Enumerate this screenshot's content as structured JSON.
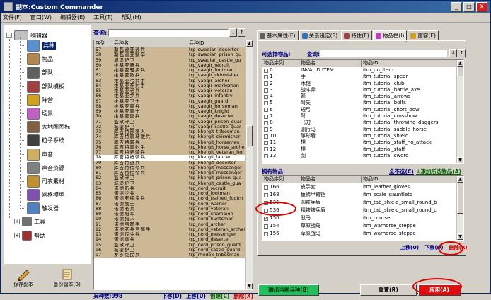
{
  "window": {
    "title": "副本:Custom Commander",
    "min": "_",
    "max": "□",
    "close": "X"
  },
  "menu": [
    "文件(F)",
    "窗口(W)",
    "编辑器(E)",
    "工具(T)",
    "帮助(H)"
  ],
  "tree": {
    "root": "编辑器",
    "items": [
      {
        "label": "兵种",
        "selected": true,
        "color": "#5a90d0"
      },
      {
        "label": "物品",
        "color": "#b08850"
      },
      {
        "label": "部队",
        "color": "#606060"
      },
      {
        "label": "部队模板",
        "color": "#a04040"
      },
      {
        "label": "阵营",
        "color": "#d0a020"
      },
      {
        "label": "场景",
        "color": "#c060c0"
      },
      {
        "label": "大地图图标",
        "color": "#806040"
      },
      {
        "label": "粒子系统",
        "color": "#404040"
      },
      {
        "label": "声音",
        "color": "#d0b060"
      },
      {
        "label": "声音资源",
        "color": "#808080"
      },
      {
        "label": "司农素材",
        "color": "#c09030"
      },
      {
        "label": "网格模型",
        "color": "#8050b0"
      },
      {
        "label": "触发器",
        "color": "#5080c0"
      }
    ],
    "tools": "工具",
    "help": "帮助"
  },
  "left_buttons": {
    "save": "保存副本",
    "backup": "备份副本(B)"
  },
  "troops": {
    "search_label": "查询:",
    "up_arrow": "↓",
    "down_arrow": "↑",
    "columns": [
      "序列",
      "兵种名",
      "兵种ID"
    ],
    "rows": [
      [
        "57",
        "斯瓦迪亚逃兵",
        "trp_swadian_deserter"
      ],
      [
        "58",
        "斯瓦迪亚狱卒",
        "trp_swadian_prison_gu"
      ],
      [
        "59",
        "城堡护卫",
        "trp_swadian_castle_gu"
      ],
      [
        "60",
        "维基亚新兵",
        "trp_vaegir_recruit"
      ],
      [
        "61",
        "维基亚轻步兵",
        "trp_vaegir_footman"
      ],
      [
        "62",
        "维基亚散兵",
        "trp_vaegir_skirmisher"
      ],
      [
        "63",
        "维基亚弓箭手",
        "trp_vaegir_archer"
      ],
      [
        "64",
        "维基亚神射手",
        "trp_vaegir_marksman"
      ],
      [
        "65",
        "维基亚老兵",
        "trp_vaegir_veteran"
      ],
      [
        "66",
        "维基亚步兵",
        "trp_vaegir_infantry"
      ],
      [
        "67",
        "维基亚卫士",
        "trp_vaegir_guard"
      ],
      [
        "68",
        "维基亚骑兵",
        "trp_vaegir_horseman"
      ],
      [
        "69",
        "维基亚骑士",
        "trp_vaegir_knight"
      ],
      [
        "70",
        "维基亚逃兵",
        "trp_vaegir_deserter"
      ],
      [
        "71",
        "监狱守卫",
        "trp_vaegir_prison_guar"
      ],
      [
        "72",
        "城堡护卫",
        "trp_vaegir_castle_guar"
      ],
      [
        "73",
        "库吉特部落人",
        "trp_khergit_tribesman"
      ],
      [
        "74",
        "库吉特骑马散兵",
        "trp_khergit_skirmisher"
      ],
      [
        "75",
        "库吉特骑兵",
        "trp_khergit_horseman"
      ],
      [
        "76",
        "库吉特骑射手",
        "trp_khergit_horse_arche"
      ],
      [
        "77",
        "库吉特老骑兵",
        "trp_khergit_veteran_hor"
      ],
      [
        "78",
        "库吉特枪骑兵",
        "trp_khergit_lancer"
      ],
      [
        "79",
        "库吉特逃兵",
        "trp_khergit_deserter"
      ],
      [
        "80",
        "库吉特传令兵",
        "trp_khergit_messenger"
      ],
      [
        "81",
        "库吉特传令兵",
        "trp_khergit_messenger"
      ],
      [
        "82",
        "监狱守卫",
        "trp_khergit_prison_gua"
      ],
      [
        "83",
        "城堡护卫",
        "trp_khergit_castle_gua"
      ],
      [
        "84",
        "诺德新兵",
        "trp_nord_recruit"
      ],
      [
        "85",
        "诺德步兵",
        "trp_nord_footman"
      ],
      [
        "86",
        "诺德老练步兵",
        "trp_nord_trained_footm"
      ],
      [
        "87",
        "诺德战士",
        "trp_nord_warrior"
      ],
      [
        "88",
        "诺德老兵",
        "trp_nord_veteran"
      ],
      [
        "89",
        "诺德冠军",
        "trp_nord_champion"
      ],
      [
        "90",
        "诺德猎人",
        "trp_nord_huntsman"
      ],
      [
        "91",
        "诺德弓箭手",
        "trp_nord_archer"
      ],
      [
        "92",
        "诺德老兵弓箭手",
        "trp_nord_veteran_archer"
      ],
      [
        "93",
        "诺德传令兵",
        "trp_nord_messenger"
      ],
      [
        "94",
        "诺德逃兵",
        "trp_nord_deserter"
      ],
      [
        "95",
        "监狱守卫",
        "trp_nord_prison_guard"
      ],
      [
        "96",
        "城堡护卫",
        "trp_nord_castle_guard"
      ],
      [
        "97",
        "罗多克民兵",
        "trp_rhodok_tribesman"
      ]
    ],
    "highlighted_index": 21,
    "count_label": "兵种数:998",
    "links": {
      "down": "下移(D)",
      "up": "上移(U)",
      "create": "创建(C)",
      "delete": "删除(X)"
    }
  },
  "tabs": [
    "基本属性(E)",
    "关系设定(S)",
    "特性(E)",
    "物品栏(I)",
    "面容(E)"
  ],
  "active_tab": 3,
  "available": {
    "label": "可选择物品:",
    "search_label": "查询:",
    "columns": [
      "物品序列",
      "物品名",
      "物品ID"
    ],
    "rows": [
      [
        "0",
        "INVALID ITEM",
        "itm_no_item"
      ],
      [
        "1",
        "手",
        "itm_tutorial_spear"
      ],
      [
        "2",
        "木棍",
        "itm_tutorial_club"
      ],
      [
        "3",
        "战斗斧",
        "itm_tutorial_battle_axe"
      ],
      [
        "4",
        "箭",
        "itm_tutorial_arrows"
      ],
      [
        "5",
        "弩矢",
        "itm_tutorial_bolts"
      ],
      [
        "6",
        "短弓",
        "itm_tutorial_short_bow"
      ],
      [
        "7",
        "弩",
        "itm_tutorial_crossbow"
      ],
      [
        "8",
        "飞刀",
        "itm_tutorial_throwing_daggers"
      ],
      [
        "9",
        "驯行马",
        "itm_tutorial_saddle_horse"
      ],
      [
        "10",
        "箏形盾",
        "itm_tutorial_shield"
      ],
      [
        "11",
        "棍",
        "itm_tutorial_staff_no_attack"
      ],
      [
        "12",
        "棍",
        "itm_tutorial_staff"
      ],
      [
        "13",
        "剑",
        "itm_tutorial_sword"
      ]
    ]
  },
  "owned": {
    "label": "拥有物品:",
    "clear_all": "全不选(C)",
    "add_new": "添加所选物品(A)",
    "columns": [
      "物品序列",
      "物品名",
      "物品ID"
    ],
    "rows": [
      [
        "166",
        "皮手套",
        "itm_leather_gloves"
      ],
      [
        "168",
        "鱼鳞甲臂铠",
        "itm_scale_gauntlets"
      ],
      [
        "535",
        "圆铁兵盾",
        "itm_tab_shield_small_round_b"
      ],
      [
        "536",
        "精铁铁兵盾",
        "itm_tab_shield_small_round_c"
      ],
      [
        "150",
        "驳马",
        "itm_courser"
      ],
      [
        "154",
        "草原战马",
        "itm_warhorse_steppe"
      ],
      [
        "156",
        "草原战马",
        "itm_warhorse_steppe"
      ]
    ],
    "checked_index": 4,
    "links": {
      "up": "上移(U)",
      "down": "下移(D)",
      "delete": "删除(R)"
    }
  },
  "buttons": {
    "export": "输出当前兵种(B)",
    "reset": "重置(R)",
    "apply": "应用(A)"
  },
  "colors": {
    "accent_green": "#22c05c",
    "alert_red": "#e01010",
    "row_tan": "#cdb896",
    "title_blue": "#0a246a"
  }
}
